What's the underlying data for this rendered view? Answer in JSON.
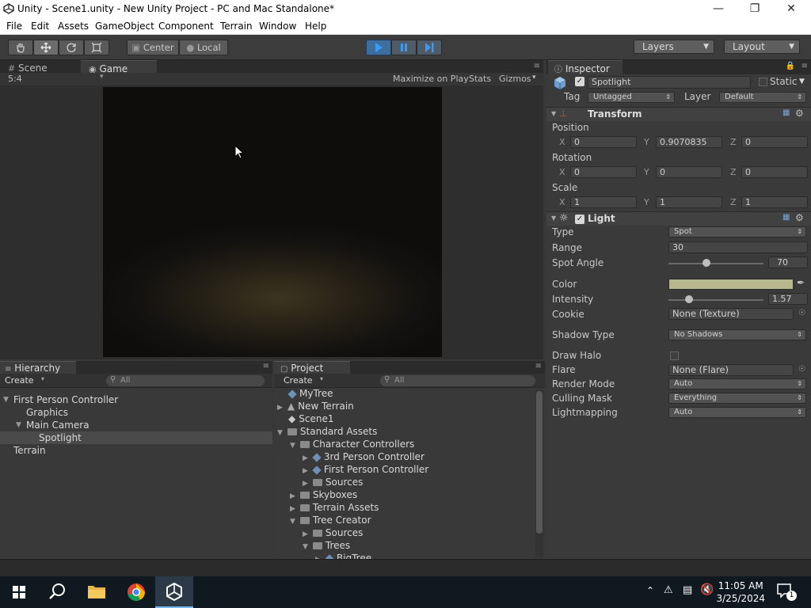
{
  "window": {
    "title": "Unity - Scene1.unity - New Unity Project - PC and Mac Standalone*",
    "controls": [
      "minimize",
      "maximize",
      "close"
    ]
  },
  "menu": [
    "File",
    "Edit",
    "Assets",
    "GameObject",
    "Component",
    "Terrain",
    "Window",
    "Help"
  ],
  "toolbar": {
    "pivot": "Center",
    "space": "Local",
    "layers": "Layers",
    "layout": "Layout"
  },
  "scene_tabs": {
    "scene": "Scene",
    "game": "Game"
  },
  "game_bar": {
    "aspect": "5:4",
    "maximize": "Maximize on Play",
    "stats": "Stats",
    "gizmos": "Gizmos"
  },
  "hierarchy": {
    "tab": "Hierarchy",
    "create": "Create",
    "search_placeholder": "All",
    "items": [
      "First Person Controller",
      "Graphics",
      "Main Camera",
      "Spotlight",
      "Terrain"
    ]
  },
  "project": {
    "tab": "Project",
    "create": "Create",
    "search_placeholder": "All",
    "items": [
      "MyTree",
      "New Terrain",
      "Scene1",
      "Standard Assets",
      "Character Controllers",
      "3rd Person Controller",
      "First Person Controller",
      "Sources",
      "Skyboxes",
      "Terrain Assets",
      "Tree Creator",
      "Sources",
      "Trees",
      "BigTree"
    ]
  },
  "inspector": {
    "tab": "Inspector",
    "object_name": "Spotlight",
    "static": "Static",
    "tag_label": "Tag",
    "tag": "Untagged",
    "layer_label": "Layer",
    "layer": "Default",
    "transform": {
      "header": "Transform",
      "position_label": "Position",
      "position": {
        "x": "0",
        "y": "0.9070835",
        "z": "0"
      },
      "rotation_label": "Rotation",
      "rotation": {
        "x": "0",
        "y": "0",
        "z": "0"
      },
      "scale_label": "Scale",
      "scale": {
        "x": "1",
        "y": "1",
        "z": "1"
      },
      "axis": {
        "x": "X",
        "y": "Y",
        "z": "Z"
      }
    },
    "light": {
      "header": "Light",
      "type_label": "Type",
      "type": "Spot",
      "range_label": "Range",
      "range": "30",
      "spot_angle_label": "Spot Angle",
      "spot_angle": "70",
      "color_label": "Color",
      "color": "#b8b88f",
      "intensity_label": "Intensity",
      "intensity": "1.57",
      "cookie_label": "Cookie",
      "cookie": "None (Texture)",
      "shadow_label": "Shadow Type",
      "shadow": "No Shadows",
      "halo_label": "Draw Halo",
      "flare_label": "Flare",
      "flare": "None (Flare)",
      "render_label": "Render Mode",
      "render": "Auto",
      "culling_label": "Culling Mask",
      "culling": "Everything",
      "lightmap_label": "Lightmapping",
      "lightmap": "Auto"
    }
  },
  "taskbar": {
    "time": "11:05 AM",
    "date": "3/25/2024",
    "notifications": "1"
  }
}
